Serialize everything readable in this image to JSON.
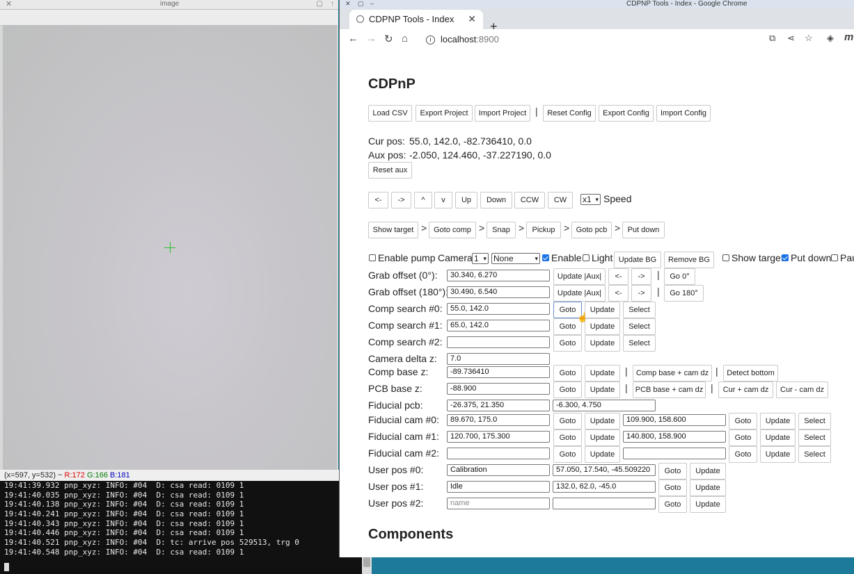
{
  "image_window": {
    "title": "image",
    "status": {
      "coords": "(x=597, y=532) ~",
      "r": "R:172",
      "g": "G:166",
      "b": "B:181"
    }
  },
  "terminal": {
    "lines": [
      "19:41:39.932 pnp_xyz: INFO: #04  D: csa read: 0109 1",
      "19:41:40.035 pnp_xyz: INFO: #04  D: csa read: 0109 1",
      "19:41:40.138 pnp_xyz: INFO: #04  D: csa read: 0109 1",
      "19:41:40.241 pnp_xyz: INFO: #04  D: csa read: 0109 1",
      "19:41:40.343 pnp_xyz: INFO: #04  D: csa read: 0109 1",
      "19:41:40.446 pnp_xyz: INFO: #04  D: csa read: 0109 1",
      "19:41:40.521 pnp_xyz: INFO: #04  D: tc: arrive pos 529513, trg 0",
      "19:41:40.548 pnp_xyz: INFO: #04  D: csa read: 0109 1"
    ]
  },
  "chrome": {
    "window_title": "CDPNP Tools - Index - Google Chrome",
    "tab_title": "CDPNP Tools - Index",
    "url_host": "localhost",
    "url_port": ":8900",
    "profile_letter": "m"
  },
  "page": {
    "title": "CDPnP",
    "top_buttons": [
      "Load CSV",
      "Export Project",
      "Import Project",
      "Reset Config",
      "Export Config",
      "Import Config"
    ],
    "cur_pos_label": "Cur pos:",
    "cur_pos_value": "55.0, 142.0, -82.736410, 0.0",
    "aux_pos_label": "Aux pos:",
    "aux_pos_value": "-2.050, 124.460, -37.227190, 0.0",
    "reset_aux": "Reset aux",
    "jog_buttons": [
      "<-",
      "->",
      "^",
      "v",
      "Up",
      "Down",
      "CCW",
      "CW"
    ],
    "speed_value": "x1",
    "speed_label": "Speed",
    "flow_buttons": [
      "Show target",
      "Goto comp",
      "Snap",
      "Pickup",
      "Goto pcb",
      "Put down"
    ],
    "enable_pump": "Enable pump",
    "camera_label": "Camera",
    "camera_value": "1",
    "bg_value": "None",
    "enable_label": "Enable",
    "light_label": "Light",
    "update_bg": "Update BG",
    "remove_bg": "Remove BG",
    "show_target": "Show target",
    "put_down": "Put down",
    "pause_partial": "Pau",
    "grab0_label": "Grab offset (0°):",
    "grab0_value": "30.340, 6.270",
    "grab180_label": "Grab offset (180°):",
    "grab180_value": "30.490, 6.540",
    "update_aux": "Update |Aux|",
    "left": "<-",
    "right": "->",
    "go0": "Go 0°",
    "go180": "Go 180°",
    "comp_search": [
      {
        "label": "Comp search #0:",
        "value": "55.0, 142.0"
      },
      {
        "label": "Comp search #1:",
        "value": "65.0, 142.0"
      },
      {
        "label": "Comp search #2:",
        "value": ""
      }
    ],
    "goto": "Goto",
    "update": "Update",
    "select": "Select",
    "camera_dz_label": "Camera delta z:",
    "camera_dz_value": "7.0",
    "comp_base_label": "Comp base z:",
    "comp_base_value": "-89.736410",
    "comp_base_cam": "Comp base + cam dz",
    "detect_bottom": "Detect bottom",
    "pcb_base_label": "PCB base z:",
    "pcb_base_value": "-88.900",
    "pcb_base_cam": "PCB base + cam dz",
    "cur_plus": "Cur + cam dz",
    "cur_minus": "Cur - cam dz",
    "fid_pcb_label": "Fiducial pcb:",
    "fid_pcb_value1": "-26.375, 21.350",
    "fid_pcb_value2": "-6.300, 4.750",
    "fid_cam": [
      {
        "label": "Fiducial cam #0:",
        "v1": "89.670, 175.0",
        "v2": "109.900, 158.600"
      },
      {
        "label": "Fiducial cam #1:",
        "v1": "120.700, 175.300",
        "v2": "140.800, 158.900"
      },
      {
        "label": "Fiducial cam #2:",
        "v1": "",
        "v2": ""
      }
    ],
    "user_pos": [
      {
        "label": "User pos #0:",
        "name": "Calibration",
        "value": "57.050, 17.540, -45.509220"
      },
      {
        "label": "User pos #1:",
        "name": "Idle",
        "value": "132.0, 62.0, -45.0"
      },
      {
        "label": "User pos #2:",
        "name": "",
        "value": ""
      }
    ],
    "name_placeholder": "name",
    "components_title": "Components"
  }
}
